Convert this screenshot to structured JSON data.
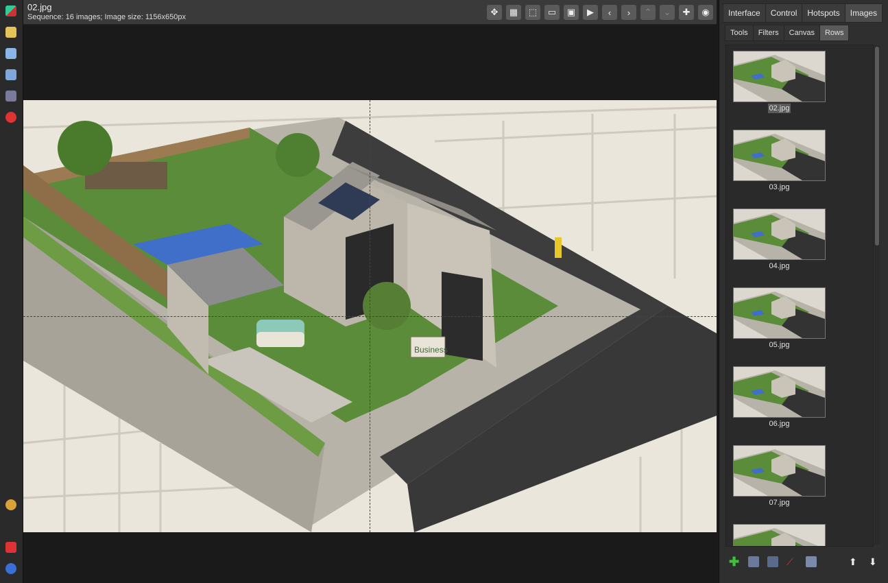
{
  "viewer": {
    "title": "02.jpg",
    "info": "Sequence: 16 images; Image size: 1156x650px",
    "tools": [
      {
        "icon": "move-icon",
        "glyph": "✥"
      },
      {
        "icon": "grid-icon",
        "glyph": "▦"
      },
      {
        "icon": "select-icon",
        "glyph": "⬚"
      },
      {
        "icon": "fit-width-icon",
        "glyph": "▭"
      },
      {
        "icon": "fit-screen-icon",
        "glyph": "▣"
      },
      {
        "icon": "play-icon",
        "glyph": "▶"
      },
      {
        "icon": "prev-icon",
        "glyph": "‹"
      },
      {
        "icon": "next-icon",
        "glyph": "›"
      },
      {
        "icon": "up-icon",
        "glyph": "⌃"
      },
      {
        "icon": "down-icon",
        "glyph": "⌄"
      },
      {
        "icon": "add-icon",
        "glyph": "✚"
      },
      {
        "icon": "record-icon",
        "glyph": "◉"
      }
    ]
  },
  "panel": {
    "tabs": [
      "Interface",
      "Control",
      "Hotspots",
      "Images"
    ],
    "active_tab": "Images",
    "subtabs": [
      "Tools",
      "Filters",
      "Canvas",
      "Rows"
    ],
    "active_subtab": "Rows",
    "thumbnails": [
      "02.jpg",
      "03.jpg",
      "04.jpg",
      "05.jpg",
      "06.jpg",
      "07.jpg",
      ""
    ],
    "selected": "02.jpg"
  },
  "colors": {
    "accent_green": "#3fbf3f",
    "accent_red": "#d33"
  }
}
